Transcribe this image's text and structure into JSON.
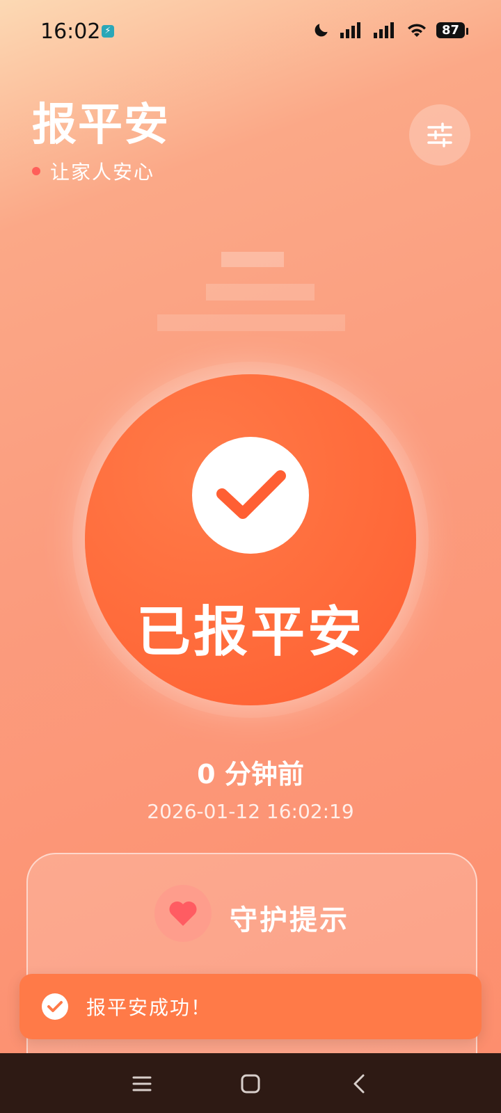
{
  "status_bar": {
    "time": "16:02",
    "battery": "87"
  },
  "header": {
    "title": "报平安",
    "subtitle": "让家人安心"
  },
  "main_button": {
    "label": "已报平安"
  },
  "last_report": {
    "relative": "0 分钟前",
    "timestamp": "2026-01-12 16:02:19"
  },
  "guard_card": {
    "title": "守护提示"
  },
  "toast": {
    "message": "报平安成功！"
  },
  "colors": {
    "accent": "#ff6a3a",
    "toast": "#ff7a48",
    "navbar": "#2e1a14"
  },
  "icons": {
    "settings": "sliders-icon",
    "check": "check-icon",
    "heart": "heart-icon"
  }
}
